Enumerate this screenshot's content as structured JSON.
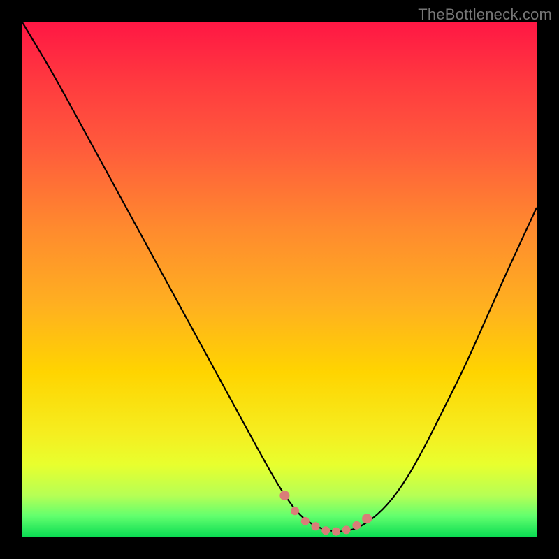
{
  "watermark": "TheBottleneck.com",
  "colors": {
    "frame_bg": "#000000",
    "curve_stroke": "#000000",
    "marker_fill": "#d97e78",
    "marker_stroke": "#c96a64"
  },
  "chart_data": {
    "type": "line",
    "title": "",
    "xlabel": "",
    "ylabel": "",
    "xlim": [
      0,
      100
    ],
    "ylim": [
      0,
      100
    ],
    "grid": false,
    "legend": false,
    "series": [
      {
        "name": "bottleneck-curve",
        "x": [
          0,
          6,
          12,
          18,
          24,
          30,
          36,
          42,
          48,
          51,
          54,
          57,
          60,
          63,
          66,
          70,
          74,
          78,
          82,
          86,
          90,
          94,
          100
        ],
        "y": [
          100,
          90,
          79,
          68,
          57,
          46,
          35,
          24,
          13,
          8,
          4,
          2,
          1,
          1,
          2,
          5,
          10,
          17,
          25,
          33,
          42,
          51,
          64
        ]
      }
    ],
    "markers": {
      "name": "highlighted-range",
      "x": [
        51,
        53,
        55,
        57,
        59,
        61,
        63,
        65,
        67
      ],
      "y": [
        8,
        5,
        3,
        2,
        1.2,
        1,
        1.3,
        2.2,
        3.5
      ]
    },
    "gradient_stops": [
      {
        "pos": 0,
        "color": "#ff1744"
      },
      {
        "pos": 40,
        "color": "#ff8a2e"
      },
      {
        "pos": 68,
        "color": "#ffd400"
      },
      {
        "pos": 92,
        "color": "#b6ff55"
      },
      {
        "pos": 100,
        "color": "#0bdc53"
      }
    ]
  }
}
